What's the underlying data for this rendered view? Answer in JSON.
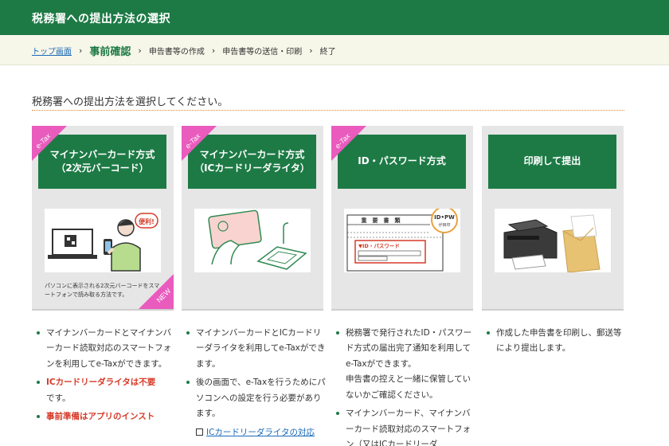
{
  "header": {
    "title": "税務署への提出方法の選択"
  },
  "breadcrumb": {
    "top": "トップ画面",
    "current": "事前確認",
    "step2": "申告書等の作成",
    "step3": "申告書等の送信・印刷",
    "step4": "終了",
    "separator": "›"
  },
  "main": {
    "heading": "税務署への提出方法を選択してください。"
  },
  "colors": {
    "brand_green": "#1d7a45",
    "tag_pink": "#e95bbd",
    "warning_red": "#d63a28",
    "link_blue": "#1a6ab8"
  },
  "cards": [
    {
      "tag": "e-Tax",
      "title": "マイナンバーカード方式\n（2次元バーコード）",
      "image_badge": "便利!",
      "caption": "パソコンに表示される2次元バーコードをスマートフォンで読み取る方法です。",
      "new_tag": "NEW"
    },
    {
      "tag": "e-Tax",
      "title": "マイナンバーカード方式\n（ICカードリーダライタ）"
    },
    {
      "tag": "e-Tax",
      "title": "ID・パスワード方式",
      "image_doc_title": "重　要　書　類",
      "image_badge_top": "ID•PW",
      "image_badge_bottom": "が目印",
      "image_label": "▼ID・パスワード"
    },
    {
      "title": "印刷して提出"
    }
  ],
  "descriptions": {
    "col1": {
      "b1": "マイナンバーカードとマイナンバーカード読取対応のスマートフォンを利用してe-Taxができます。",
      "b2_red": "ICカードリーダライタは不要",
      "b2_rest": "です。",
      "b3_red": "事前準備はアプリのインスト"
    },
    "col2": {
      "b1": "マイナンバーカードとICカードリーダライタを利用してe-Taxができます。",
      "b2": "後の画面で、e-Taxを行うためにパソコンへの設定を行う必要があります。",
      "link": "ICカードリーダライタの対応"
    },
    "col3": {
      "b1": "税務署で発行されたID・パスワード方式の届出完了通知を利用してe-Taxができます。",
      "b1_note": "申告書の控えと一緒に保管していないかご確認ください。",
      "b2": "マイナンバーカード、マイナンバーカード読取対応のスマートフォン（又はICカードリーダ"
    },
    "col4": {
      "b1": "作成した申告書を印刷し、郵送等により提出します。"
    }
  }
}
